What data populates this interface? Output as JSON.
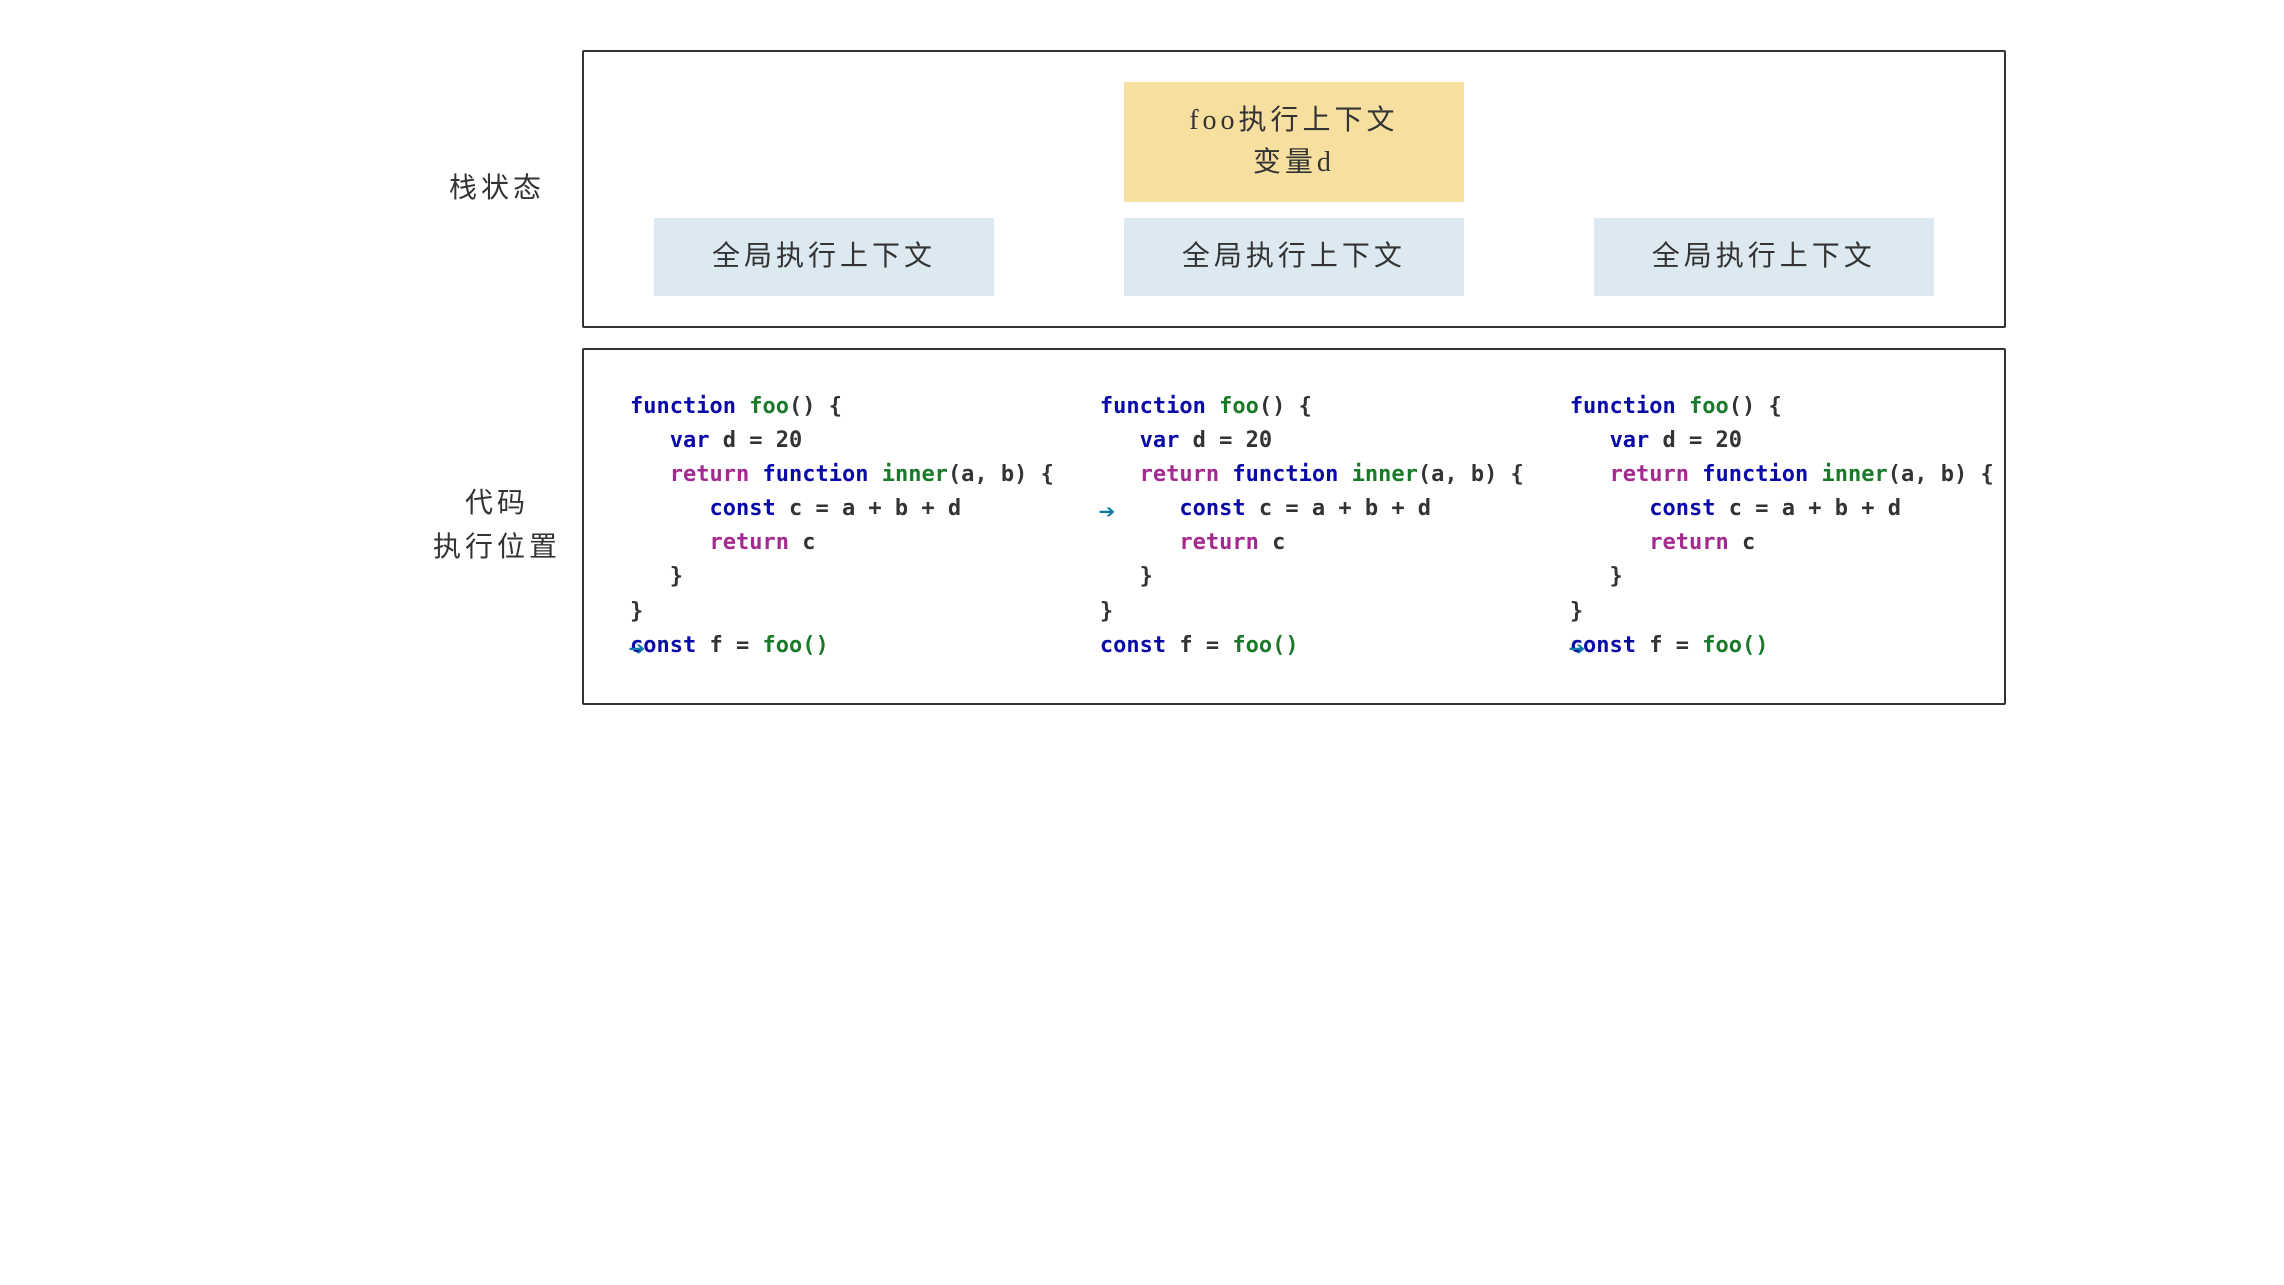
{
  "labels": {
    "stack": "栈状态",
    "code": "代码\n执行位置"
  },
  "stack_columns": [
    {
      "foo": null,
      "global": "全局执行上下文"
    },
    {
      "foo": {
        "line1": "foo执行上下文",
        "line2": "变量d"
      },
      "global": "全局执行上下文"
    },
    {
      "foo": null,
      "global": "全局执行上下文"
    }
  ],
  "code": {
    "tokens": {
      "fn_kw": "function",
      "foo": "foo",
      "inner": "inner",
      "var_kw": "var",
      "return_kw": "return",
      "const_kw": "const",
      "d_decl": "d = 20",
      "params": "(a, b) {",
      "c_decl": "c = a + b + d",
      "ret_c": "c",
      "brace_close": "}",
      "f_decl": "f = ",
      "foo_call": "foo()",
      "empty_parens": "() {"
    },
    "arrow_lines": [
      7,
      3,
      7
    ]
  }
}
